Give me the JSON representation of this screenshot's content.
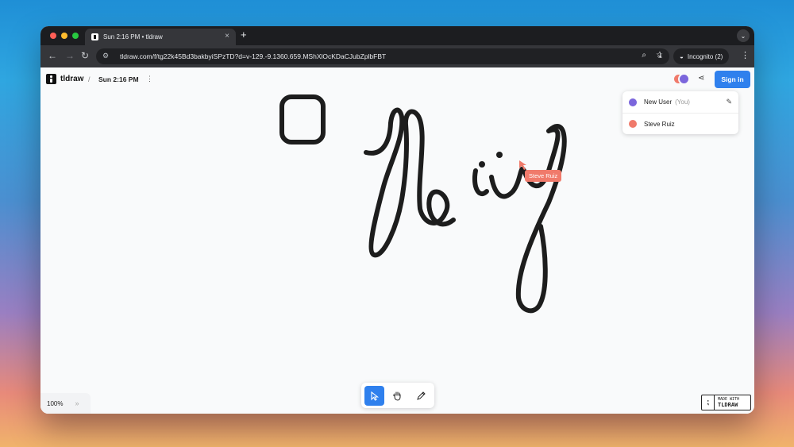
{
  "browser": {
    "tab_title": "Sun 2:16 PM • tldraw",
    "tab_close": "×",
    "new_tab": "+",
    "url": "tldraw.com/f/tg22k45Bd3bakbyiSPzTD?d=v-129.-9.1360.659.MShXlOcKDaCJubZplbFBT",
    "incognito_label": "Incognito (2)",
    "traffic_lights": [
      "#ff5f57",
      "#febc2e",
      "#28c840"
    ]
  },
  "app": {
    "brand": "tldraw",
    "separator": "/",
    "doc_title": "Sun 2:16 PM",
    "sign_in": "Sign in",
    "accent": "#2f80ed"
  },
  "people_menu": {
    "users": [
      {
        "name": "New User",
        "tag": "(You)",
        "color": "#7b66dc"
      },
      {
        "name": "Steve Ruiz",
        "color": "#f07a6b"
      }
    ]
  },
  "canvas": {
    "cursor_label": "Steve Ruiz",
    "stroke_color": "#1d1d1d"
  },
  "toolbar": {
    "tools": [
      "select-tool",
      "hand-tool",
      "draw-tool"
    ],
    "active_tool": "select-tool"
  },
  "zoom": {
    "level": "100%"
  },
  "badge": {
    "line1": "MADE WITH",
    "line2": "TLDRAW"
  }
}
